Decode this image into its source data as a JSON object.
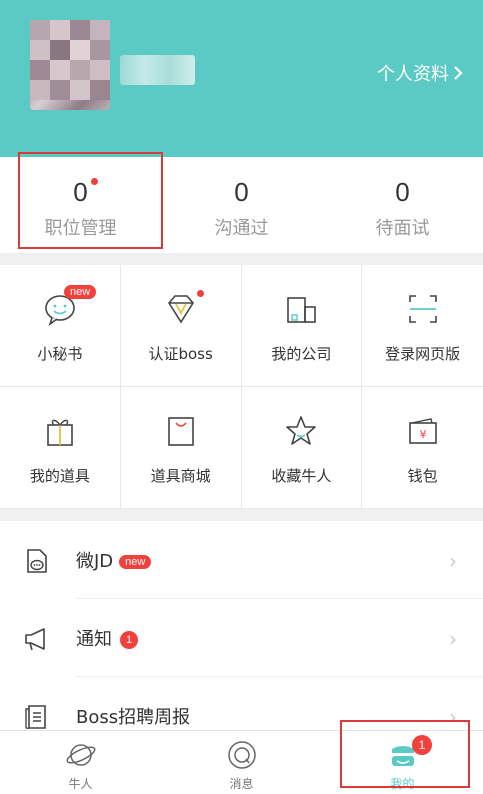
{
  "header": {
    "profile_link": "个人资料",
    "accent": "#5bcac4"
  },
  "stats": [
    {
      "value": "0",
      "label": "职位管理",
      "has_dot": true
    },
    {
      "value": "0",
      "label": "沟通过"
    },
    {
      "value": "0",
      "label": "待面试"
    }
  ],
  "tools": [
    {
      "label": "小秘书",
      "icon": "chat-bubble-icon",
      "badge": "new"
    },
    {
      "label": "认证boss",
      "icon": "diamond-icon",
      "dot": true
    },
    {
      "label": "我的公司",
      "icon": "company-icon"
    },
    {
      "label": "登录网页版",
      "icon": "scan-icon"
    },
    {
      "label": "我的道具",
      "icon": "gift-icon"
    },
    {
      "label": "道具商城",
      "icon": "shopping-bag-icon"
    },
    {
      "label": "收藏牛人",
      "icon": "star-icon"
    },
    {
      "label": "钱包",
      "icon": "wallet-icon"
    }
  ],
  "list": [
    {
      "title": "微JD",
      "badge": "new",
      "icon": "jd-icon"
    },
    {
      "title": "通知",
      "badge": "1",
      "icon": "megaphone-icon"
    },
    {
      "title": "Boss招聘周报",
      "icon": "report-icon"
    }
  ],
  "tabbar": [
    {
      "label": "牛人",
      "icon": "planet-icon"
    },
    {
      "label": "消息",
      "icon": "message-icon"
    },
    {
      "label": "我的",
      "icon": "me-icon",
      "badge": "1",
      "active": true
    }
  ],
  "colors": {
    "red": "#f2403c",
    "highlight": "#d93a3a"
  }
}
